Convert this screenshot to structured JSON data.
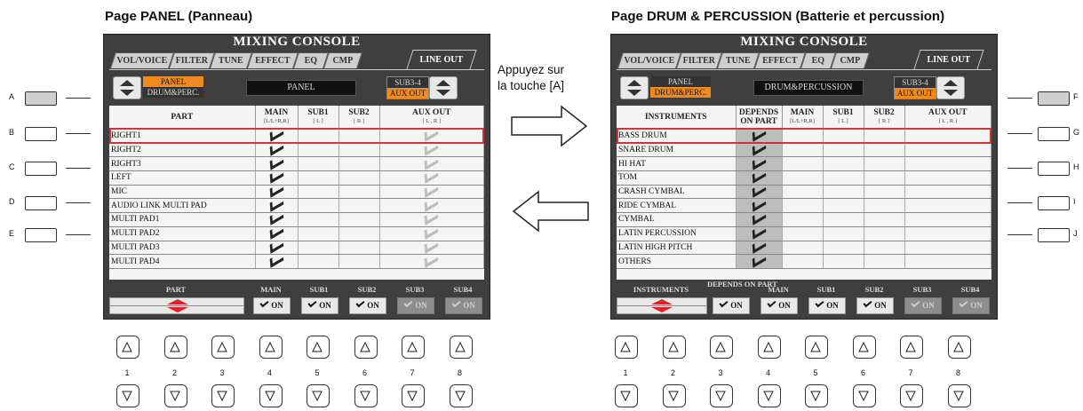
{
  "left_heading": "Page PANEL (Panneau)",
  "right_heading": "Page DRUM & PERCUSSION (Batterie et percussion)",
  "middle_instruction": [
    "Appuyez sur",
    "la touche [A]"
  ],
  "left_side_letters": [
    "A",
    "B",
    "C",
    "D",
    "E"
  ],
  "right_side_letters": [
    "F",
    "G",
    "H",
    "I",
    "J"
  ],
  "hw_numbers": [
    "1",
    "2",
    "3",
    "4",
    "5",
    "6",
    "7",
    "8"
  ],
  "panel": {
    "title": "MIXING CONSOLE",
    "tabs": [
      "VOL/VOICE",
      "FILTER",
      "TUNE",
      "EFFECT",
      "EQ",
      "CMP",
      "LINE OUT"
    ],
    "page_selector": [
      "PANEL",
      "DRUM&PERC."
    ],
    "name_display": "PANEL",
    "sub_selector": [
      "SUB3-4",
      "AUX OUT"
    ],
    "columns": [
      {
        "label": "PART",
        "sub": ""
      },
      {
        "label": "MAIN",
        "sub": "[L/L+R,R]"
      },
      {
        "label": "SUB1",
        "sub": "[ L ]"
      },
      {
        "label": "SUB2",
        "sub": "[ R ]"
      },
      {
        "label": "AUX OUT",
        "sub": "[ L , R ]"
      }
    ],
    "rows": [
      "RIGHT1",
      "RIGHT2",
      "RIGHT3",
      "LEFT",
      "MIC",
      "AUDIO LINK MULTI PAD",
      "MULTI PAD1",
      "MULTI PAD2",
      "MULTI PAD3",
      "MULTI PAD4"
    ],
    "bottom_labels": [
      "PART",
      "MAIN",
      "SUB1",
      "SUB2",
      "SUB3",
      "SUB4"
    ],
    "on_label": "ON"
  },
  "drum": {
    "title": "MIXING CONSOLE",
    "tabs": [
      "VOL/VOICE",
      "FILTER",
      "TUNE",
      "EFFECT",
      "EQ",
      "CMP",
      "LINE OUT"
    ],
    "page_selector": [
      "PANEL",
      "DRUM&PERC."
    ],
    "name_display": "DRUM&PERCUSSION",
    "sub_selector": [
      "SUB3-4",
      "AUX OUT"
    ],
    "columns": [
      {
        "label": "INSTRUMENTS",
        "sub": ""
      },
      {
        "label": "DEPENDS ON PART",
        "sub": ""
      },
      {
        "label": "MAIN",
        "sub": "[L/L+R,R]"
      },
      {
        "label": "SUB1",
        "sub": "[ L ]"
      },
      {
        "label": "SUB2",
        "sub": "[ R ]"
      },
      {
        "label": "AUX OUT",
        "sub": "[ L , R ]"
      }
    ],
    "rows": [
      "BASS DRUM",
      "SNARE DRUM",
      "HI HAT",
      "TOM",
      "CRASH CYMBAL",
      "RIDE CYMBAL",
      "CYMBAL",
      "LATIN PERCUSSION",
      "LATIN HIGH PITCH",
      "OTHERS"
    ],
    "bottom_labels": [
      "INSTRUMENTS",
      "DEPENDS ON PART",
      "MAIN",
      "SUB1",
      "SUB2",
      "SUB3",
      "SUB4"
    ],
    "on_label": "ON"
  },
  "colors": {
    "highlight": "#f08a1e",
    "selection_frame": "#d1353a",
    "screen_bg": "#3f3f3f"
  }
}
